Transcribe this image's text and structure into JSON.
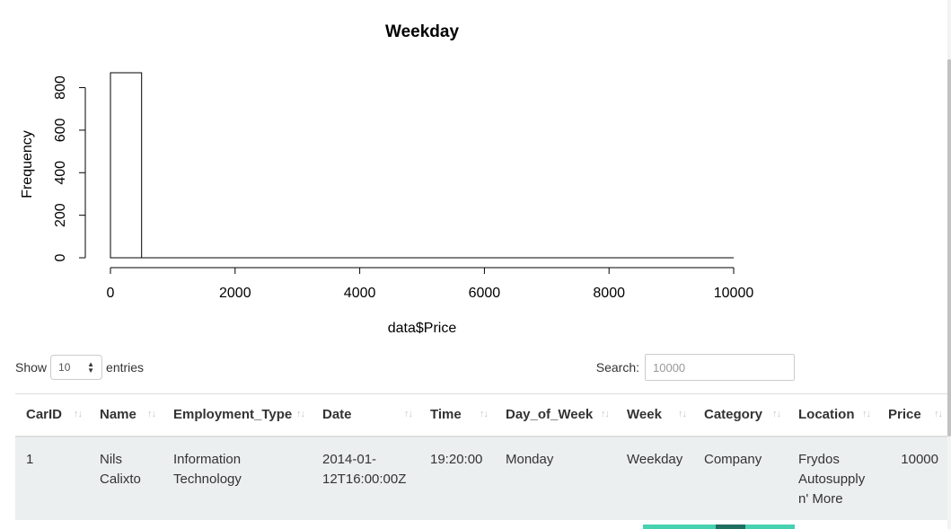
{
  "chart_data": {
    "type": "bar",
    "title": "Weekday",
    "xlabel": "data$Price",
    "ylabel": "Frequency",
    "bins": [
      [
        0,
        500
      ]
    ],
    "values": [
      870
    ],
    "xlim": [
      0,
      10000
    ],
    "ylim": [
      0,
      870
    ],
    "x_ticks": [
      "0",
      "2000",
      "4000",
      "6000",
      "8000",
      "10000"
    ],
    "y_ticks": [
      "0",
      "200",
      "400",
      "600",
      "800"
    ],
    "x_tick_values": [
      0,
      2000,
      4000,
      6000,
      8000,
      10000
    ],
    "y_tick_values": [
      0,
      200,
      400,
      600,
      800
    ],
    "grid": false,
    "legend": "none"
  },
  "controls": {
    "show_label": "Show",
    "length_value": "10",
    "entries_label": "entries",
    "search_label": "Search:",
    "search_value": "10000"
  },
  "table": {
    "columns": [
      "CarID",
      "Name",
      "Employment_Type",
      "Date",
      "Time",
      "Day_of_Week",
      "Week",
      "Category",
      "Location",
      "Price"
    ],
    "rows": [
      [
        "1",
        "Nils Calixto",
        "Information Technology",
        "2014-01-12T16:00:00Z",
        "19:20:00",
        "Monday",
        "Weekday",
        "Company",
        "Frydos Autosupply n' More",
        "10000"
      ]
    ]
  },
  "colors": {
    "pager_light": "#46d1b0",
    "pager_dark": "#1f6e5f",
    "row_background": "#eceff0"
  }
}
